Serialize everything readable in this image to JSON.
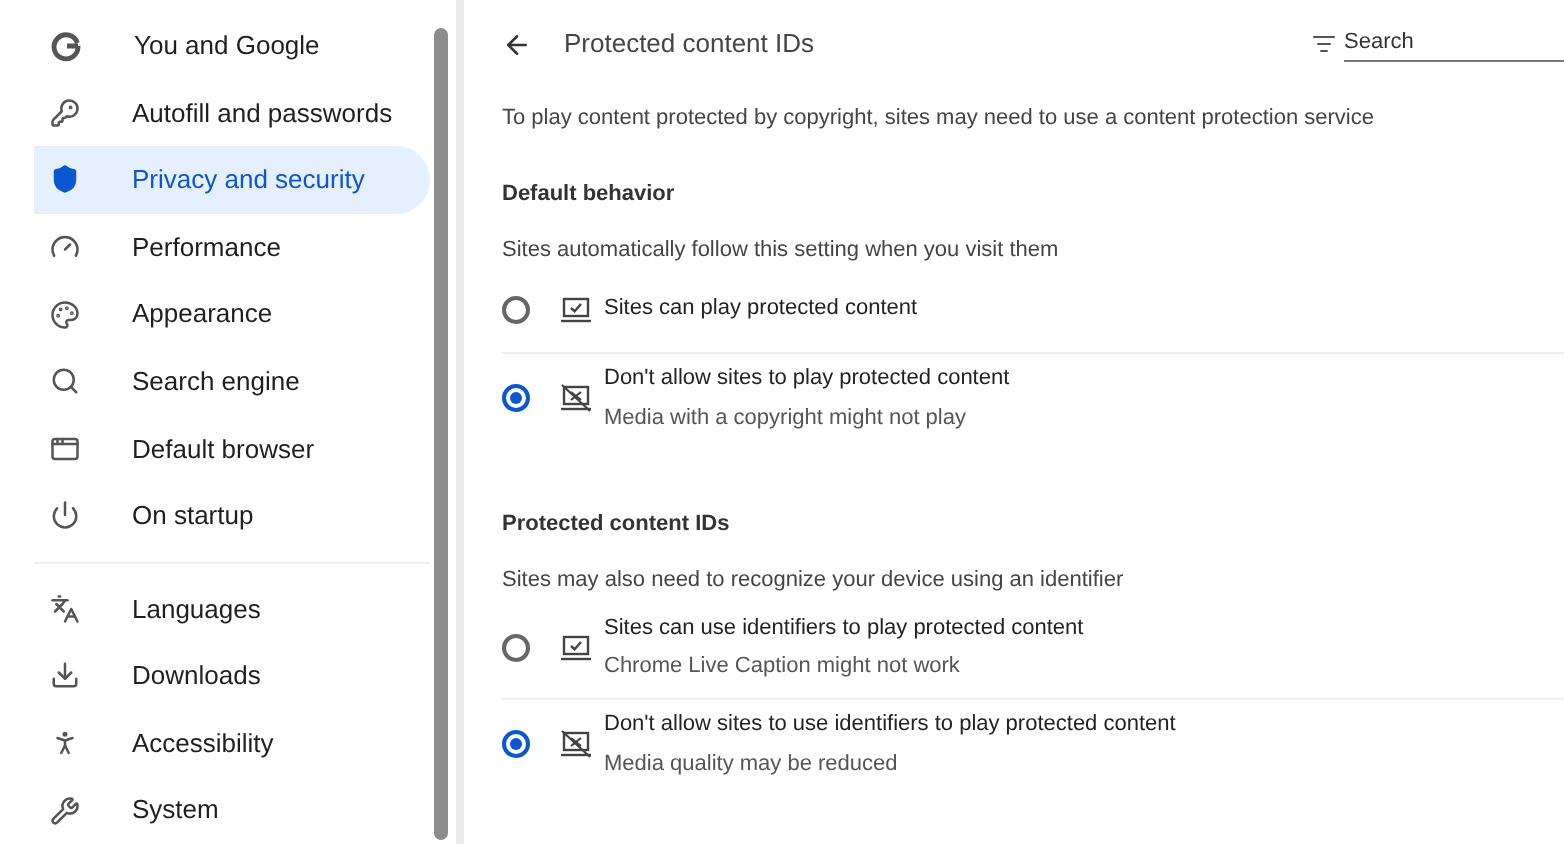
{
  "sidebar": {
    "items": [
      {
        "label": "You and Google",
        "selected": false
      },
      {
        "label": "Autofill and passwords",
        "selected": false
      },
      {
        "label": "Privacy and security",
        "selected": true
      },
      {
        "label": "Performance",
        "selected": false
      },
      {
        "label": "Appearance",
        "selected": false
      },
      {
        "label": "Search engine",
        "selected": false
      },
      {
        "label": "Default browser",
        "selected": false
      },
      {
        "label": "On startup",
        "selected": false
      },
      {
        "label": "Languages",
        "selected": false
      },
      {
        "label": "Downloads",
        "selected": false
      },
      {
        "label": "Accessibility",
        "selected": false
      },
      {
        "label": "System",
        "selected": false
      }
    ]
  },
  "header": {
    "title": "Protected content IDs",
    "search": {
      "placeholder": "Search"
    }
  },
  "description": "To play content protected by copyright, sites may need to use a content protection service",
  "sections": [
    {
      "title": "Default behavior",
      "subtitle": "Sites automatically follow this setting when you visit them",
      "options": [
        {
          "kind": "allow",
          "label": "Sites can play protected content",
          "selected": false
        },
        {
          "kind": "block",
          "label": "Don't allow sites to play protected content",
          "sublabel": "Media with a copyright might not play",
          "selected": true
        }
      ]
    },
    {
      "title": "Protected content IDs",
      "subtitle": "Sites may also need to recognize your device using an identifier",
      "options": [
        {
          "kind": "allow",
          "label": "Sites can use identifiers to play protected content",
          "sublabel": "Chrome Live Caption might not work",
          "selected": false
        },
        {
          "kind": "block",
          "label": "Don't allow sites to use identifiers to play protected content",
          "sublabel": "Media quality may be reduced",
          "selected": true
        }
      ]
    }
  ]
}
